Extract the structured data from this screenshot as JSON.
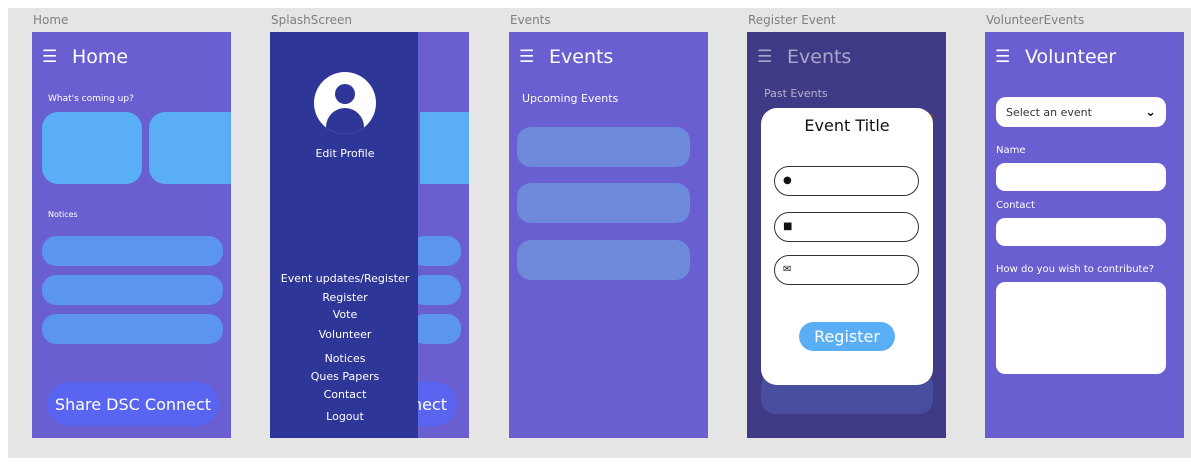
{
  "frames": {
    "home": {
      "label": "Home",
      "title": "Home",
      "coming_up": "What's coming up?",
      "notices": "Notices",
      "share": "Share DSC Connect"
    },
    "splash": {
      "label": "SplashScreen",
      "edit_profile": "Edit Profile",
      "menu": [
        "Event updates/Register",
        "Register",
        "Vote",
        "Volunteer",
        "Notices",
        "Ques Papers",
        "Contact",
        "Logout"
      ],
      "share_fragment": "nect"
    },
    "events": {
      "label": "Events",
      "title": "Events",
      "upcoming": "Upcoming Events"
    },
    "register": {
      "label": "Register Event",
      "title": "Events",
      "past": "Past Events",
      "event_title": "Event Title",
      "register_button": "Register"
    },
    "volunteer": {
      "label": "VolunteerEvents",
      "title": "Volunteer",
      "select_placeholder": "Select an event",
      "name_label": "Name",
      "contact_label": "Contact",
      "contribute_label": "How do you wish to contribute?"
    }
  },
  "icons": {
    "menu": "menu-icon",
    "user_circle": "user-circle-icon",
    "id_card": "id-card-icon",
    "mail": "mail-icon",
    "chevron": "chevron-down-icon",
    "avatar": "avatar-icon"
  },
  "colors": {
    "frame_bg": "#6a5fd0",
    "card_blue": "#5aaef6",
    "pill_blue": "#5c95ef",
    "share_btn": "#5965f1",
    "drawer": "#2e3697",
    "register_btn": "#5aaef6"
  }
}
